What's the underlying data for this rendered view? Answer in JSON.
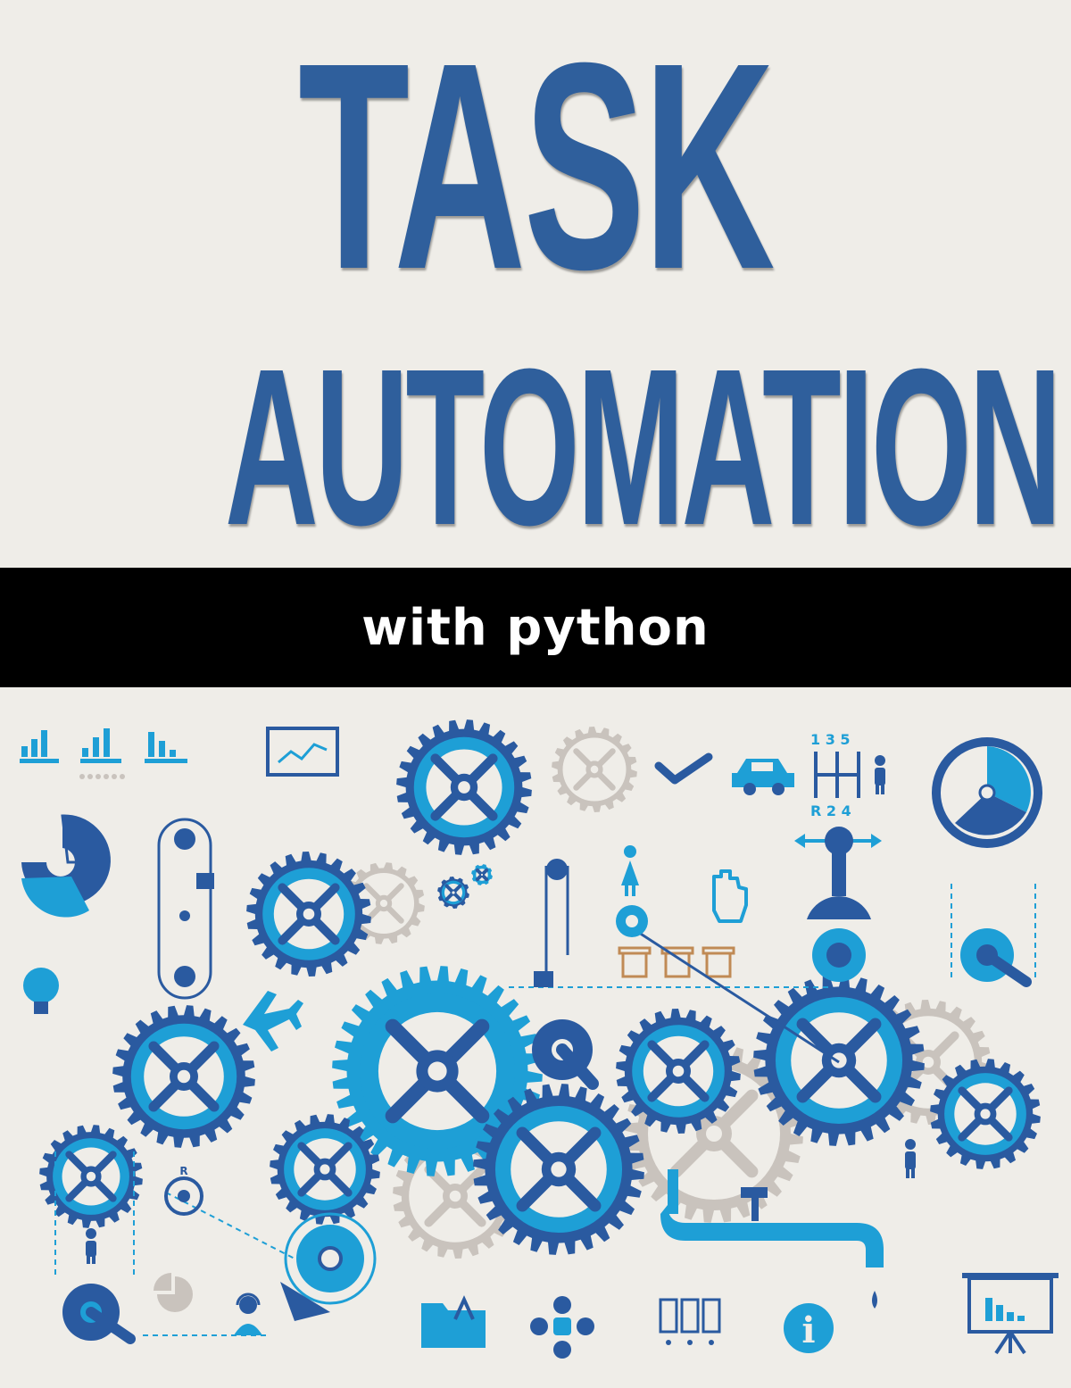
{
  "cover": {
    "title_line_1": "TASK",
    "title_line_2": "AUTOMATION",
    "subtitle": "with python"
  },
  "illustration": {
    "gearshift_numbers_top": "1 3 5",
    "gearshift_numbers_bottom": "R 2 4",
    "registered_mark": "R",
    "info_glyph": "i"
  },
  "colors": {
    "background": "#efede8",
    "title_blue": "#2f5f9c",
    "band": "#000000",
    "dark_blue": "#2a5aa0",
    "light_blue": "#1e9fd6",
    "gray": "#c9c3bd"
  },
  "icons": [
    "bar-chart-icon",
    "line-chart-icon",
    "gear-icon",
    "checkmark-icon",
    "car-icon",
    "gearshift-icon",
    "person-icon",
    "donut-chart-icon",
    "lightbulb-icon",
    "airplane-icon",
    "hand-cursor-icon",
    "trash-icon",
    "joystick-icon",
    "faucet-icon",
    "folder-icon",
    "network-icon",
    "info-icon",
    "presentation-board-icon",
    "headset-person-icon",
    "pie-chart-icon"
  ]
}
